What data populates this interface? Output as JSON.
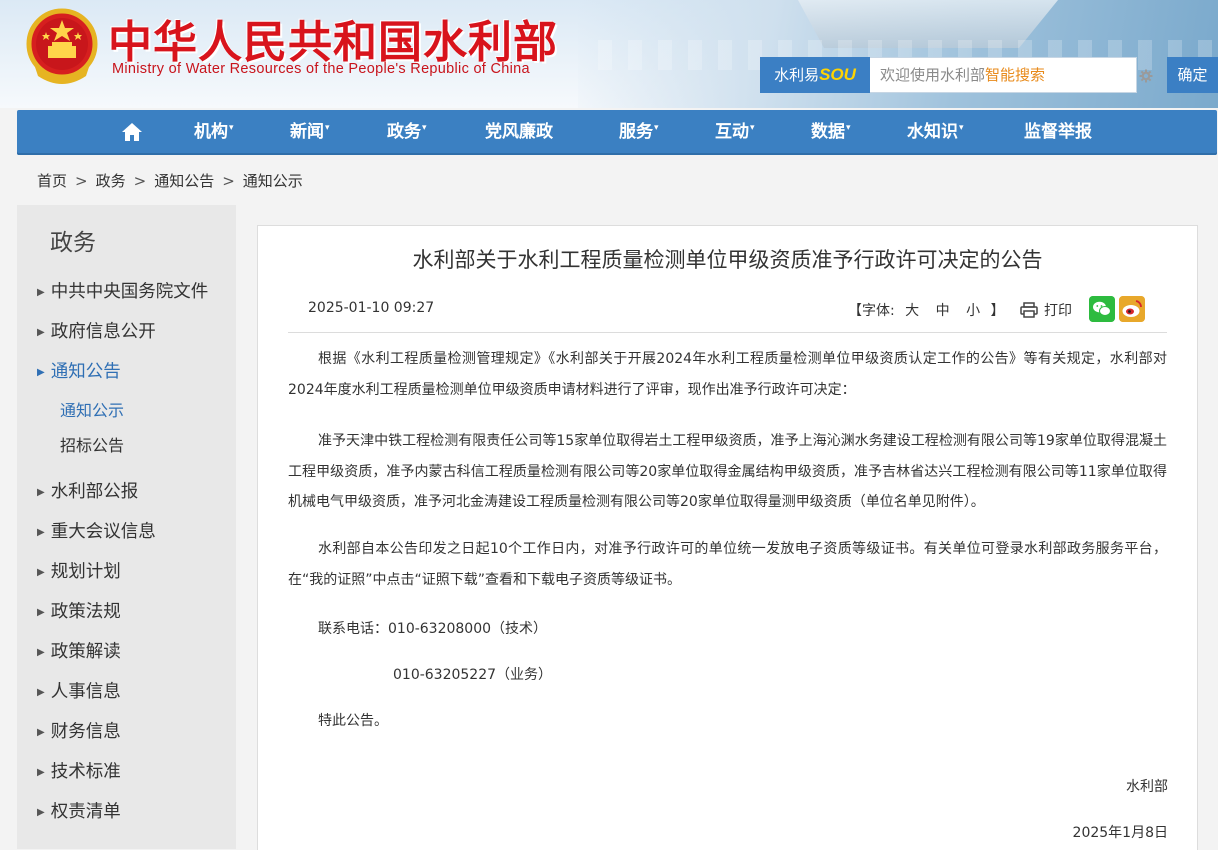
{
  "header": {
    "site_title_cn": "中华人民共和国水利部",
    "site_title_en": "Ministry of Water Resources of the People's Republic of China",
    "search": {
      "brand_prefix": "水利易",
      "brand_logo": "SOU",
      "placeholder_prefix": "欢迎使用水利部",
      "placeholder_highlight": "智能搜索",
      "submit_label": "确定"
    }
  },
  "nav": {
    "items": [
      {
        "label": "机构",
        "dropdown": true
      },
      {
        "label": "新闻",
        "dropdown": true
      },
      {
        "label": "政务",
        "dropdown": true
      },
      {
        "label": "党风廉政",
        "dropdown": false
      },
      {
        "label": "服务",
        "dropdown": true
      },
      {
        "label": "互动",
        "dropdown": true
      },
      {
        "label": "数据",
        "dropdown": true
      },
      {
        "label": "水知识",
        "dropdown": true
      },
      {
        "label": "监督举报",
        "dropdown": false
      }
    ],
    "caret": "▾"
  },
  "breadcrumb": {
    "items": [
      "首页",
      "政务",
      "通知公告",
      "通知公示"
    ],
    "separator": ">"
  },
  "sidebar": {
    "title": "政务",
    "items": [
      "中共中央国务院文件",
      "政府信息公开",
      "通知公告",
      "水利部公报",
      "重大会议信息",
      "规划计划",
      "政策法规",
      "政策解读",
      "人事信息",
      "财务信息",
      "技术标准",
      "权责清单"
    ],
    "subitems": [
      "通知公示",
      "招标公告"
    ],
    "active_item": "通知公告",
    "active_subitem": "通知公示"
  },
  "article": {
    "title": "水利部关于水利工程质量检测单位甲级资质准予行政许可决定的公告",
    "date": "2025-01-10 09:27",
    "font_label": "【字体:",
    "font_sizes": [
      "大",
      "中",
      "小"
    ],
    "font_close": "】",
    "print_label": "打印",
    "paragraphs": [
      "根据《水利工程质量检测管理规定》《水利部关于开展2024年水利工程质量检测单位甲级资质认定工作的公告》等有关规定，水利部对2024年度水利工程质量检测单位甲级资质申请材料进行了评审，现作出准予行政许可决定：",
      "准予天津中铁工程检测有限责任公司等15家单位取得岩土工程甲级资质，准予上海沁渊水务建设工程检测有限公司等19家单位取得混凝土工程甲级资质，准予内蒙古科信工程质量检测有限公司等20家单位取得金属结构甲级资质，准予吉林省达兴工程检测有限公司等11家单位取得机械电气甲级资质，准予河北金涛建设工程质量检测有限公司等20家单位取得量测甲级资质（单位名单见附件）。",
      "水利部自本公告印发之日起10个工作日内，对准予行政许可的单位统一发放电子资质等级证书。有关单位可登录水利部政务服务平台，在“我的证照”中点击“证照下载”查看和下载电子资质等级证书。"
    ],
    "contact_line1": "联系电话：010-63208000（技术）",
    "contact_line2": "010-63205227（业务）",
    "closing": "特此公告。",
    "signature": "水利部",
    "signature_date": "2025年1月8日"
  },
  "colors": {
    "brand_red": "#d8141c",
    "nav_blue": "#3b80c2",
    "active_link": "#2f6fb4",
    "wechat_green": "#2dbb3f",
    "weibo_orange": "#e8a82b"
  }
}
